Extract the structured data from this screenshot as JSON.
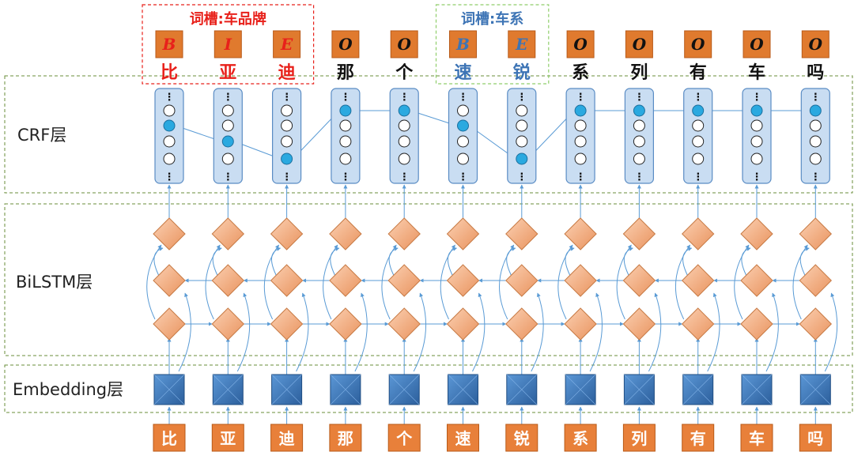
{
  "layers": {
    "crf": "CRF层",
    "bilstm": "BiLSTM层",
    "embedding": "Embedding层"
  },
  "slots": [
    {
      "title": "词槽:车品牌",
      "start": 0,
      "end": 2,
      "color": "#e8211b"
    },
    {
      "title": "词槽:车系",
      "start": 5,
      "end": 6,
      "color": "#3d74b5"
    }
  ],
  "tokens": [
    "比",
    "亚",
    "迪",
    "那",
    "个",
    "速",
    "锐",
    "系",
    "列",
    "有",
    "车",
    "吗"
  ],
  "tags": [
    "B",
    "I",
    "E",
    "O",
    "O",
    "B",
    "E",
    "O",
    "O",
    "O",
    "O",
    "O"
  ],
  "tag_colors": {
    "red": "#e8211b",
    "blue": "#3d74b5",
    "black": "#111111"
  },
  "crf_path": [
    1,
    2,
    3,
    0,
    0,
    1,
    3,
    0,
    0,
    0,
    0,
    0
  ],
  "colors": {
    "tag_box": "#e07a2e",
    "input_box": "#e8803a",
    "embedding": "#3e7cc0",
    "lstm": "#f2a87c",
    "crf_column": "#c9ddf2",
    "selected_node": "#2aa9e0",
    "arrow": "#5a9bd5",
    "dash_green": "#6a8e3a"
  }
}
